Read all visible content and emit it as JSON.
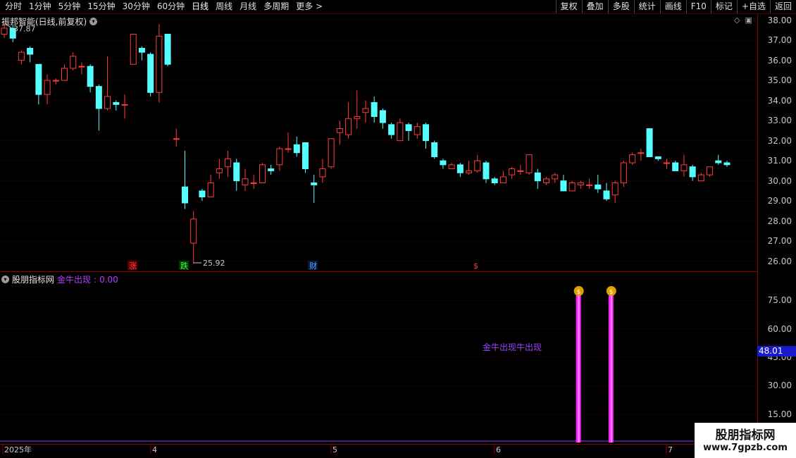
{
  "toolbar": {
    "left": [
      "分时",
      "1分钟",
      "5分钟",
      "15分钟",
      "30分钟",
      "60分钟",
      "日线",
      "周线",
      "月线",
      "多周期",
      "更多 >"
    ],
    "right": [
      "复权",
      "叠加",
      "多股",
      "统计",
      "画线",
      "F10",
      "标记",
      "+自选",
      "返回"
    ]
  },
  "stock": {
    "title": "振邦智能(日线,前复权)",
    "high_label": "37.87",
    "low_label": "25.92"
  },
  "price_axis": [
    "38.00",
    "37.00",
    "36.00",
    "35.00",
    "34.00",
    "33.00",
    "32.00",
    "31.00",
    "30.00",
    "29.00",
    "28.00",
    "27.00",
    "26.00"
  ],
  "events": [
    {
      "label": "涨",
      "color": "#ff4040",
      "bg": "#5a0000"
    },
    {
      "label": "跌",
      "color": "#40ff40",
      "bg": "#003a00"
    },
    {
      "label": "财",
      "color": "#60a0ff",
      "bg": "#001a3a"
    },
    {
      "label": "$",
      "color": "#ff4040",
      "bg": "#000"
    }
  ],
  "indicator": {
    "name": "股朋指标网",
    "field": "金牛出现",
    "value": "0.00",
    "axis": [
      "75.00",
      "60.00",
      "45.00",
      "30.00",
      "15.00"
    ],
    "current": "48.01",
    "overlay_text": "金牛出现牛出现",
    "signal_icon": "money-bag-icon"
  },
  "time_axis": [
    "2025年",
    "4",
    "5",
    "6",
    "7"
  ],
  "watermark": {
    "line1": "股朋指标网",
    "line2": "www.7gpzb.com"
  },
  "chart_data": {
    "type": "candlestick",
    "ylim": [
      25.5,
      38.3
    ],
    "candles": [
      [
        37.3,
        37.6,
        37.1,
        37.8
      ],
      [
        37.6,
        37.1,
        36.9,
        37.8
      ],
      [
        36.0,
        36.4,
        35.8,
        36.5
      ],
      [
        36.6,
        36.3,
        35.9,
        36.7
      ],
      [
        35.8,
        34.3,
        33.8,
        35.8
      ],
      [
        34.3,
        35.0,
        33.8,
        35.3
      ],
      [
        35.0,
        35.0,
        34.8,
        35.1
      ],
      [
        35.0,
        35.6,
        35.0,
        35.8
      ],
      [
        35.6,
        36.2,
        35.5,
        36.4
      ],
      [
        35.7,
        35.7,
        35.3,
        35.9
      ],
      [
        35.7,
        34.7,
        34.4,
        35.8
      ],
      [
        34.7,
        33.6,
        32.5,
        34.8
      ],
      [
        33.6,
        34.2,
        33.5,
        36.2
      ],
      [
        33.9,
        33.8,
        33.5,
        34.0
      ],
      [
        33.8,
        33.8,
        33.1,
        34.3
      ],
      [
        35.8,
        37.3,
        35.8,
        37.3
      ],
      [
        36.6,
        36.4,
        36.0,
        36.7
      ],
      [
        36.3,
        34.4,
        34.2,
        36.4
      ],
      [
        34.4,
        37.2,
        33.9,
        37.8
      ],
      [
        37.3,
        35.8,
        35.7,
        37.3
      ],
      [
        32.1,
        32.1,
        31.7,
        32.6
      ],
      [
        29.7,
        28.9,
        28.6,
        31.5
      ],
      [
        26.9,
        28.1,
        25.9,
        28.5
      ],
      [
        29.5,
        29.2,
        29.0,
        29.6
      ],
      [
        29.2,
        29.9,
        29.2,
        30.3
      ],
      [
        30.4,
        30.6,
        30.1,
        31.1
      ],
      [
        30.7,
        31.1,
        30.2,
        31.5
      ],
      [
        30.9,
        30.0,
        29.5,
        31.1
      ],
      [
        29.8,
        30.1,
        29.5,
        30.6
      ],
      [
        29.9,
        29.9,
        29.6,
        30.3
      ],
      [
        29.9,
        30.8,
        29.9,
        30.9
      ],
      [
        30.6,
        30.5,
        30.3,
        30.8
      ],
      [
        30.8,
        31.6,
        30.5,
        31.7
      ],
      [
        31.6,
        31.6,
        31.4,
        32.4
      ],
      [
        31.8,
        31.4,
        31.2,
        32.2
      ],
      [
        31.9,
        30.6,
        30.4,
        31.9
      ],
      [
        29.9,
        29.8,
        28.9,
        30.3
      ],
      [
        30.2,
        30.6,
        29.9,
        31.1
      ],
      [
        30.7,
        32.1,
        30.6,
        32.1
      ],
      [
        32.4,
        32.6,
        31.8,
        33.0
      ],
      [
        32.3,
        33.1,
        32.1,
        33.9
      ],
      [
        33.1,
        33.2,
        32.6,
        34.5
      ],
      [
        33.4,
        33.6,
        32.9,
        34.0
      ],
      [
        33.9,
        33.2,
        32.9,
        34.2
      ],
      [
        33.5,
        32.9,
        32.6,
        33.6
      ],
      [
        32.8,
        32.3,
        32.1,
        32.9
      ],
      [
        32.0,
        32.9,
        32.0,
        33.1
      ],
      [
        32.8,
        32.5,
        32.0,
        32.9
      ],
      [
        32.3,
        32.7,
        32.1,
        32.9
      ],
      [
        32.8,
        32.0,
        31.6,
        32.9
      ],
      [
        31.9,
        31.2,
        31.1,
        32.0
      ],
      [
        31.0,
        30.8,
        30.6,
        31.1
      ],
      [
        30.6,
        30.8,
        30.6,
        30.9
      ],
      [
        30.8,
        30.4,
        30.2,
        30.9
      ],
      [
        30.4,
        30.5,
        30.3,
        31.0
      ],
      [
        30.5,
        31.0,
        30.4,
        31.3
      ],
      [
        30.9,
        30.1,
        29.9,
        31.0
      ],
      [
        30.1,
        29.9,
        29.8,
        30.2
      ],
      [
        29.9,
        30.2,
        29.9,
        30.5
      ],
      [
        30.3,
        30.6,
        30.1,
        30.7
      ],
      [
        30.5,
        30.5,
        30.3,
        30.8
      ],
      [
        30.4,
        31.3,
        30.3,
        31.3
      ],
      [
        30.4,
        30.0,
        29.6,
        30.6
      ],
      [
        29.9,
        30.1,
        29.8,
        30.2
      ],
      [
        30.1,
        30.3,
        29.9,
        30.4
      ],
      [
        30.0,
        29.5,
        29.5,
        30.3
      ],
      [
        29.5,
        29.9,
        29.5,
        30.0
      ],
      [
        29.8,
        29.9,
        29.6,
        30.0
      ],
      [
        29.8,
        29.8,
        29.6,
        30.1
      ],
      [
        29.8,
        29.6,
        29.4,
        30.3
      ],
      [
        29.5,
        29.1,
        29.0,
        29.9
      ],
      [
        29.3,
        29.9,
        28.9,
        30.0
      ],
      [
        29.9,
        30.9,
        29.7,
        31.0
      ],
      [
        30.9,
        31.3,
        30.8,
        31.4
      ],
      [
        31.4,
        31.4,
        31.0,
        31.6
      ],
      [
        32.6,
        31.2,
        31.2,
        32.6
      ],
      [
        31.2,
        31.1,
        31.0,
        31.2
      ],
      [
        30.9,
        30.9,
        30.6,
        31.1
      ],
      [
        30.9,
        30.5,
        30.5,
        31.0
      ],
      [
        30.5,
        30.8,
        30.2,
        31.3
      ],
      [
        30.7,
        30.2,
        30.0,
        30.8
      ],
      [
        30.0,
        30.3,
        30.0,
        30.4
      ],
      [
        30.3,
        30.7,
        30.2,
        30.7
      ],
      [
        31.0,
        30.9,
        30.8,
        31.3
      ],
      [
        30.9,
        30.8,
        30.7,
        31.0
      ]
    ],
    "indicator_series": {
      "spike_positions": [
        0.795,
        0.84
      ],
      "value_range": [
        0,
        90
      ]
    }
  }
}
